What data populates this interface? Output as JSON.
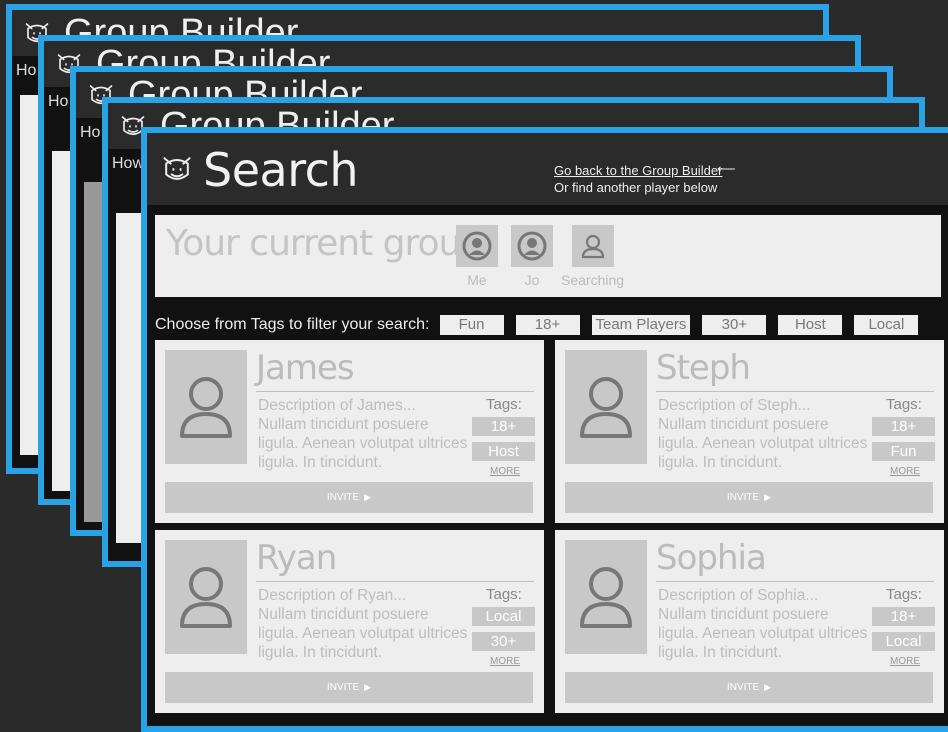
{
  "back_windows": [
    {
      "title": "Group Builder",
      "sub": "Ho"
    },
    {
      "title": "Group Builder",
      "sub": "Ho"
    },
    {
      "title": "Group Builder",
      "sub": "Ho"
    },
    {
      "title": "Group Builder",
      "sub": "How"
    }
  ],
  "header": {
    "title": "Search",
    "back_link": "Go back to the Group Builder",
    "back_arrow": "🡐",
    "find_text": "Or find another player below"
  },
  "group": {
    "label": "Your current group:",
    "members": [
      {
        "name": "Me",
        "icon": "avatar-filled-icon"
      },
      {
        "name": "Jo",
        "icon": "avatar-filled-icon"
      },
      {
        "name": "Searching",
        "icon": "avatar-outline-icon"
      }
    ]
  },
  "filter": {
    "label": "Choose from Tags to filter your search:",
    "tags": [
      "Fun",
      "18+",
      "Team Players",
      "30+",
      "Host",
      "Local"
    ]
  },
  "cards": [
    {
      "name": "James",
      "desc_first": "Description of James...",
      "desc_rest": "Nullam tincidunt posuere ligula. Aenean volutpat ultrices ligula. In tincidunt.",
      "tags_label": "Tags:",
      "tags": [
        "18+",
        "Host"
      ],
      "more": "MORE",
      "invite": "INVITE",
      "invite_icon": "▶"
    },
    {
      "name": "Steph",
      "desc_first": "Description of Steph...",
      "desc_rest": "Nullam tincidunt posuere ligula. Aenean volutpat ultrices ligula. In tincidunt.",
      "tags_label": "Tags:",
      "tags": [
        "18+",
        "Fun"
      ],
      "more": "MORE",
      "invite": "INVITE",
      "invite_icon": "▶"
    },
    {
      "name": "Ryan",
      "desc_first": "Description of Ryan...",
      "desc_rest": "Nullam tincidunt posuere ligula. Aenean volutpat ultrices ligula. In tincidunt.",
      "tags_label": "Tags:",
      "tags": [
        "Local",
        "30+"
      ],
      "more": "MORE",
      "invite": "INVITE",
      "invite_icon": "▶"
    },
    {
      "name": "Sophia",
      "desc_first": "Description of Sophia...",
      "desc_rest": "Nullam tincidunt posuere ligula. Aenean volutpat ultrices ligula. In tincidunt.",
      "tags_label": "Tags:",
      "tags": [
        "18+",
        "Local"
      ],
      "more": "MORE",
      "invite": "INVITE",
      "invite_icon": "▶"
    }
  ],
  "colors": {
    "accent_border": "#29a3e6",
    "header_bg": "#2b2b2b",
    "panel_bg": "#eeeeee",
    "placeholder_grey": "#c8c8c8"
  }
}
